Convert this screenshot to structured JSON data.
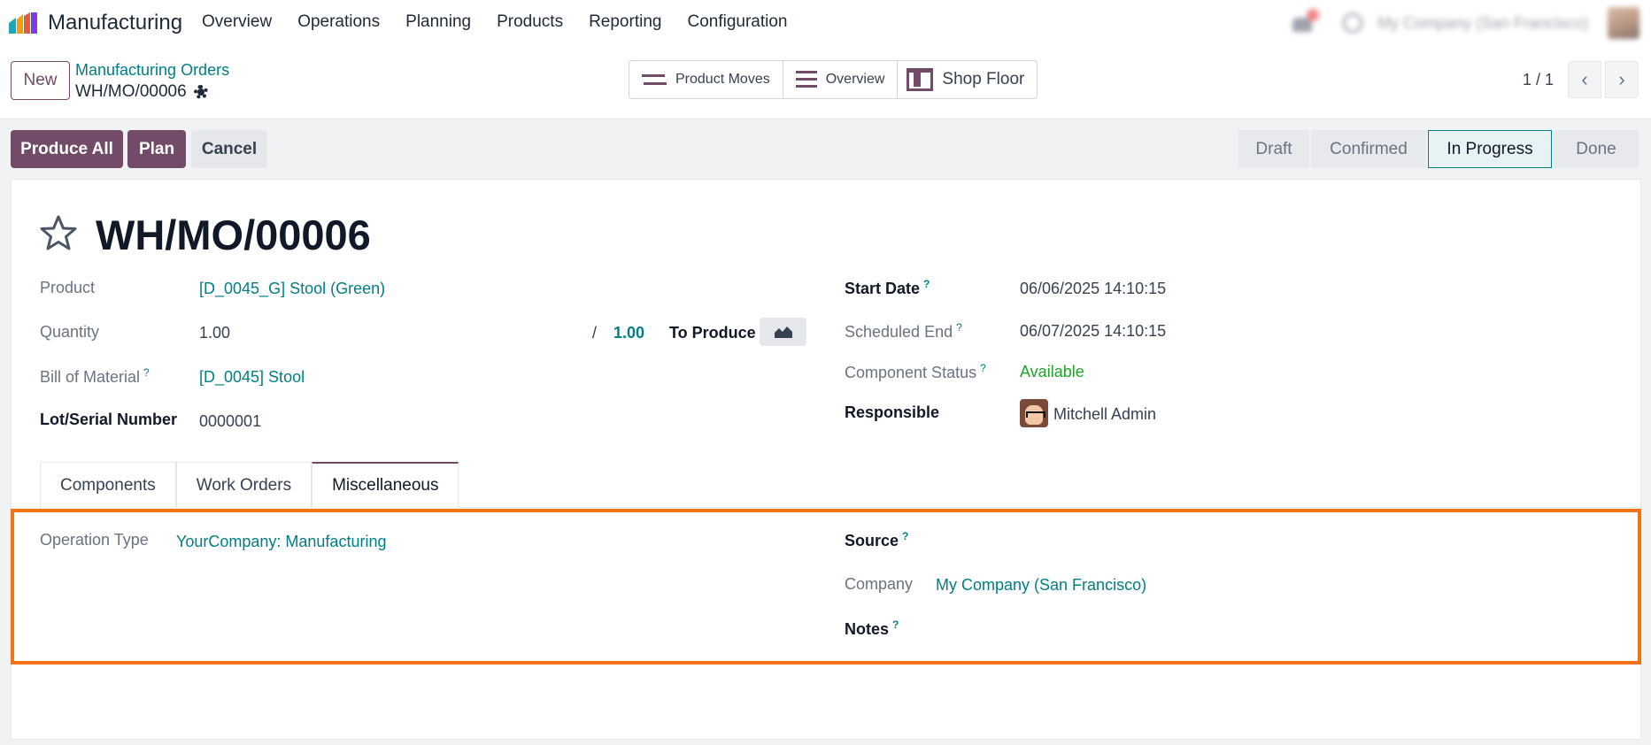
{
  "navbar": {
    "app_name": "Manufacturing",
    "menu": [
      "Overview",
      "Operations",
      "Planning",
      "Products",
      "Reporting",
      "Configuration"
    ],
    "company": "My Company (San Francisco)"
  },
  "control": {
    "new_label": "New",
    "breadcrumb": "Manufacturing Orders",
    "record_name": "WH/MO/00006",
    "smart_buttons": [
      "Product Moves",
      "Overview",
      "Shop Floor"
    ],
    "pager": "1 / 1"
  },
  "actions": {
    "produce_all": "Produce All",
    "plan": "Plan",
    "cancel": "Cancel"
  },
  "statusbar": {
    "stages": [
      "Draft",
      "Confirmed",
      "In Progress",
      "Done"
    ],
    "active": "In Progress"
  },
  "form": {
    "title": "WH/MO/00006",
    "product_label": "Product",
    "product_value": "[D_0045_G] Stool (Green)",
    "quantity_label": "Quantity",
    "quantity_value": "1.00",
    "quantity_sep": "/",
    "quantity_max": "1.00",
    "to_produce": "To Produce",
    "bom_label": "Bill of Material",
    "bom_value": "[D_0045] Stool",
    "lot_label": "Lot/Serial Number",
    "lot_value": "0000001",
    "start_label": "Start Date",
    "start_value": "06/06/2025 14:10:15",
    "end_label": "Scheduled End",
    "end_value": "06/07/2025 14:10:15",
    "component_status_label": "Component Status",
    "component_status_value": "Available",
    "responsible_label": "Responsible",
    "responsible_value": "Mitchell Admin",
    "help_mark": "?"
  },
  "tabs": [
    "Components",
    "Work Orders",
    "Miscellaneous"
  ],
  "misc": {
    "operation_type_label": "Operation Type",
    "operation_type_value": "YourCompany: Manufacturing",
    "source_label": "Source",
    "company_label": "Company",
    "company_value": "My Company (San Francisco)",
    "notes_label": "Notes"
  },
  "colors": {
    "brand": "#714b67",
    "link": "#017e84",
    "highlight": "#f47216",
    "available": "#21a32a"
  }
}
